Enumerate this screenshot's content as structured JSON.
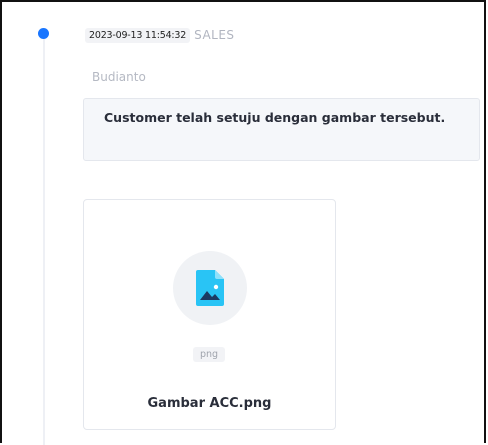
{
  "log_entry": {
    "timestamp": "2023-09-13 11:54:32",
    "role": "SALES",
    "author": "Budianto",
    "message": "Customer telah setuju dengan gambar tersebut."
  },
  "attachment": {
    "extension": "png",
    "filename": "Gambar ACC.png",
    "icon": "image-file-icon"
  },
  "colors": {
    "timeline_dot": "#1976ff",
    "file_icon": "#29c4f5"
  }
}
